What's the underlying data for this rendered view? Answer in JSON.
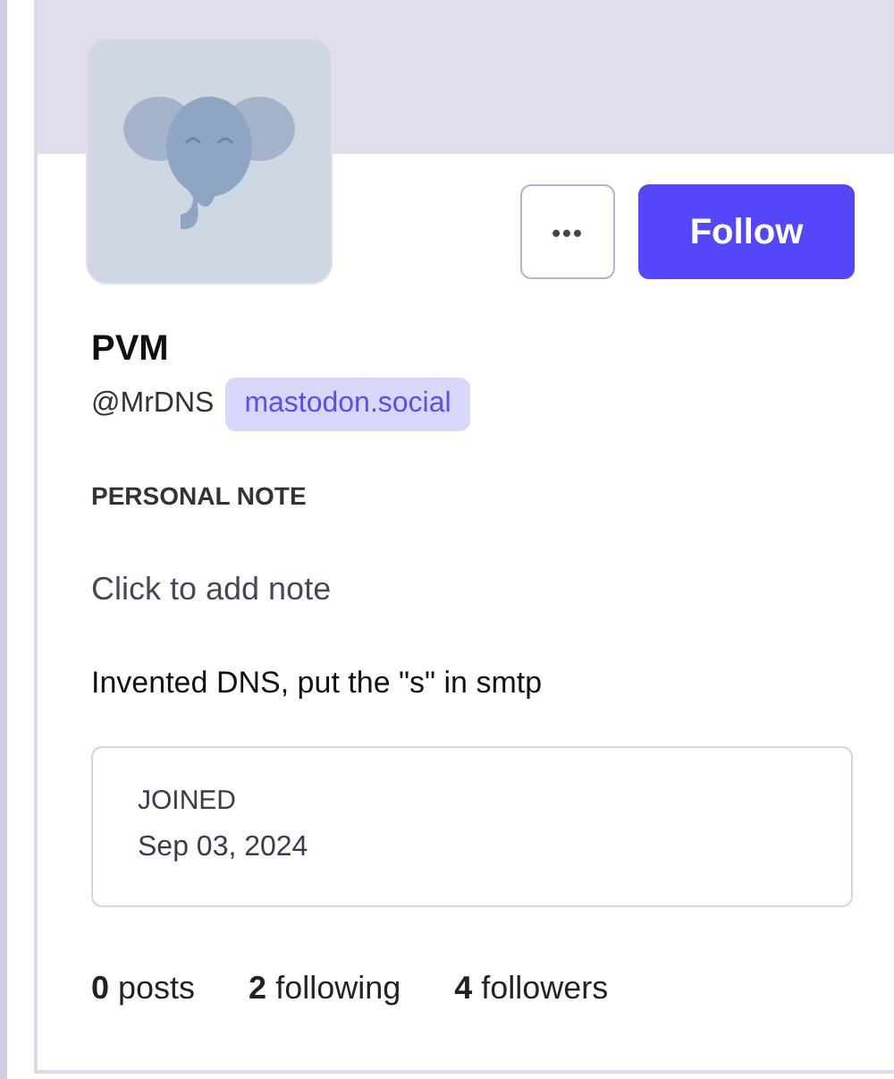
{
  "profile": {
    "display_name": "PVM",
    "handle": "@MrDNS",
    "server": "mastodon.social"
  },
  "actions": {
    "more": "•••",
    "follow": "Follow"
  },
  "personal_note": {
    "label": "PERSONAL NOTE",
    "placeholder": "Click to add note"
  },
  "bio": "Invented DNS, put the \"s\" in smtp",
  "joined": {
    "label": "JOINED",
    "date": "Sep 03, 2024"
  },
  "stats": [
    {
      "count": "0",
      "label": "posts"
    },
    {
      "count": "2",
      "label": "following"
    },
    {
      "count": "4",
      "label": "followers"
    }
  ]
}
